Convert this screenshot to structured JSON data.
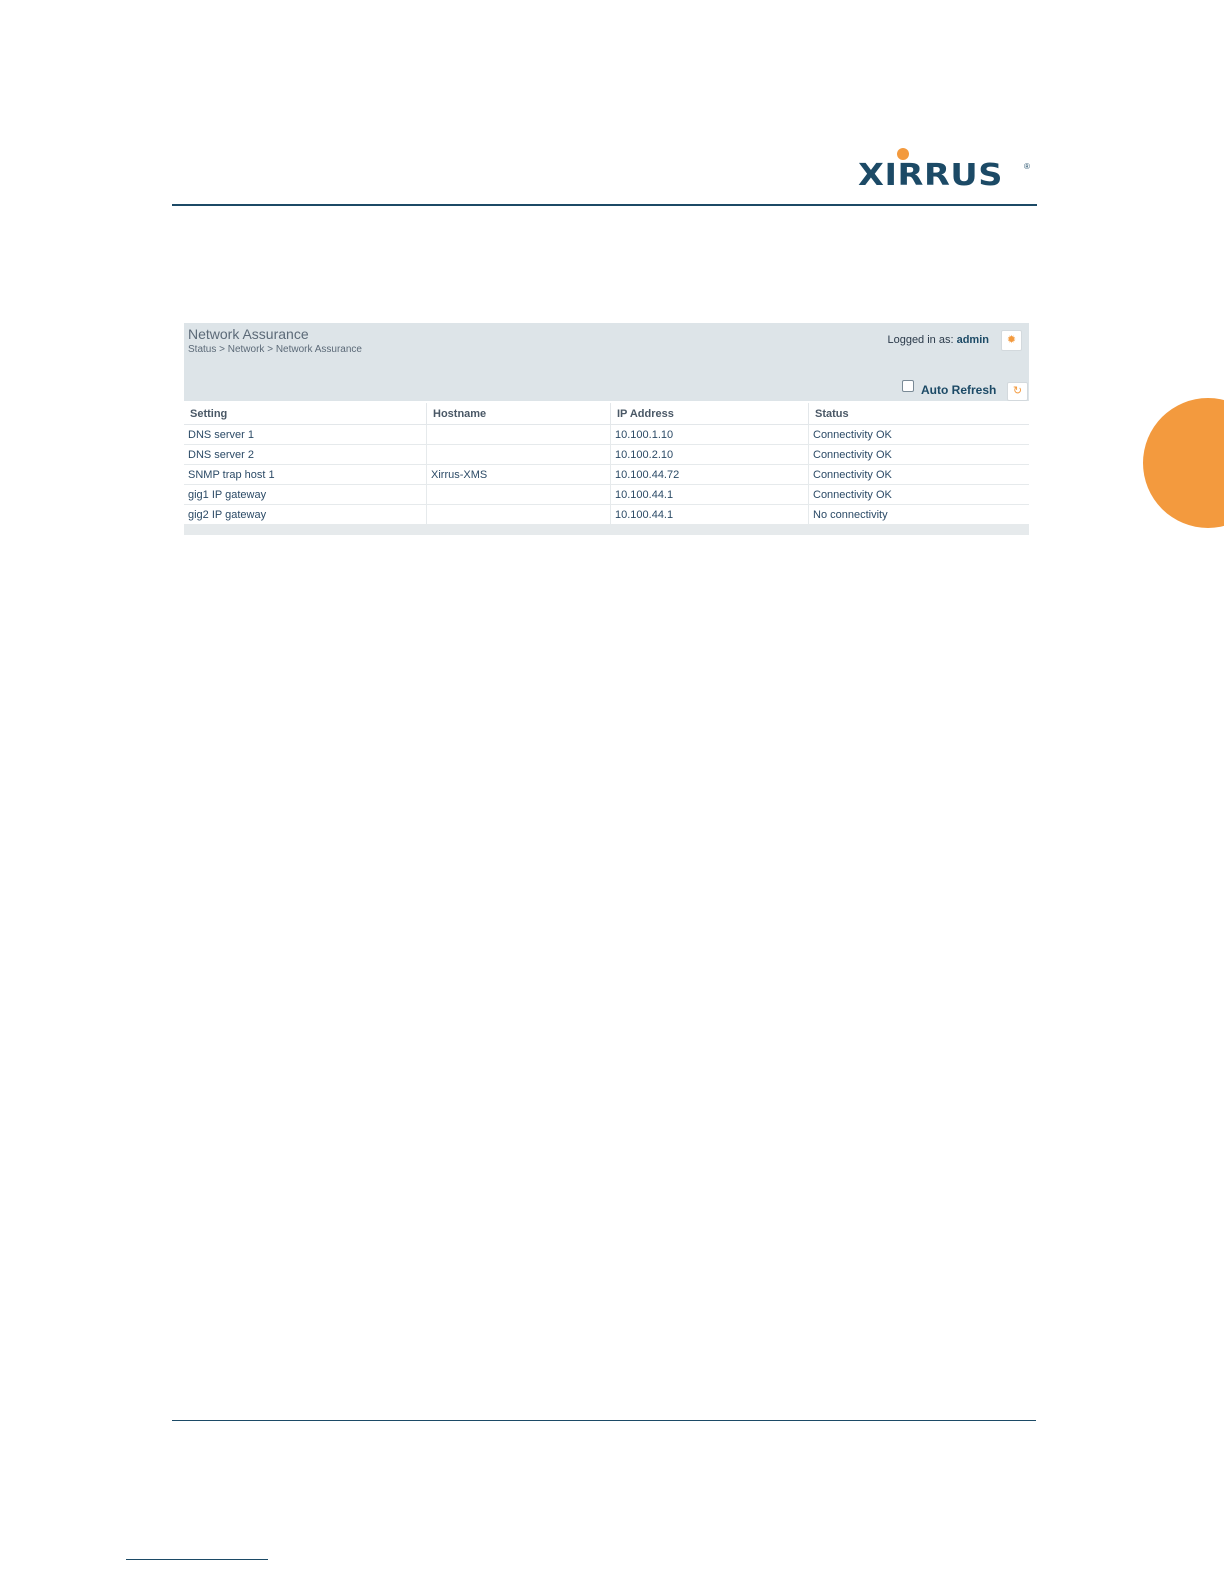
{
  "brand": {
    "logo_text": "XIRRUS",
    "registered_mark": "®",
    "accent": "#f39a3e",
    "primary": "#1c4a66"
  },
  "panel": {
    "title": "Network Assurance",
    "breadcrumb": "Status > Network > Network Assurance",
    "logged_in_label": "Logged in as:",
    "user": "admin",
    "settings_icon": "gear-icon",
    "auto_refresh_label": "Auto Refresh",
    "auto_refresh_checked": false,
    "refresh_icon": "refresh-icon"
  },
  "table": {
    "headers": [
      "Setting",
      "Hostname",
      "IP Address",
      "Status"
    ],
    "rows": [
      [
        "DNS server 1",
        "",
        "10.100.1.10",
        "Connectivity OK"
      ],
      [
        "DNS server 2",
        "",
        "10.100.2.10",
        "Connectivity OK"
      ],
      [
        "SNMP trap host 1",
        "Xirrus-XMS",
        "10.100.44.72",
        "Connectivity OK"
      ],
      [
        "gig1 IP gateway",
        "",
        "10.100.44.1",
        "Connectivity OK"
      ],
      [
        "gig2 IP gateway",
        "",
        "10.100.44.1",
        "No connectivity"
      ]
    ]
  }
}
